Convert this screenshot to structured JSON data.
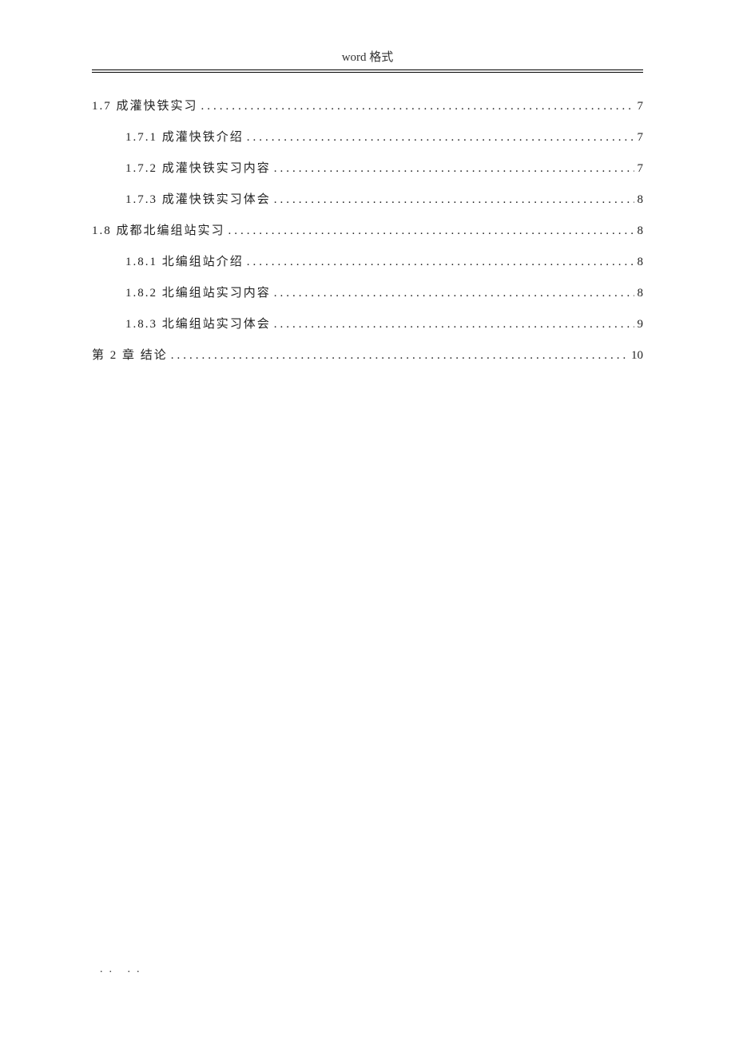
{
  "header": {
    "title": "word 格式"
  },
  "toc": [
    {
      "level": 1,
      "label": "1.7 成灌快铁实习",
      "page": "7"
    },
    {
      "level": 2,
      "label": "1.7.1 成灌快铁介绍",
      "page": "7"
    },
    {
      "level": 2,
      "label": "1.7.2 成灌快铁实习内容",
      "page": "7"
    },
    {
      "level": 2,
      "label": "1.7.3 成灌快铁实习体会",
      "page": "8"
    },
    {
      "level": 1,
      "label": "1.8 成都北编组站实习",
      "page": "8"
    },
    {
      "level": 2,
      "label": "1.8.1 北编组站介绍",
      "page": "8"
    },
    {
      "level": 2,
      "label": "1.8.2 北编组站实习内容",
      "page": "8"
    },
    {
      "level": 2,
      "label": "1.8.3 北编组站实习体会",
      "page": "9"
    },
    {
      "level": 1,
      "label": "第 2 章  结论",
      "page": "10"
    }
  ],
  "footer": {
    "dots": ".. .."
  }
}
